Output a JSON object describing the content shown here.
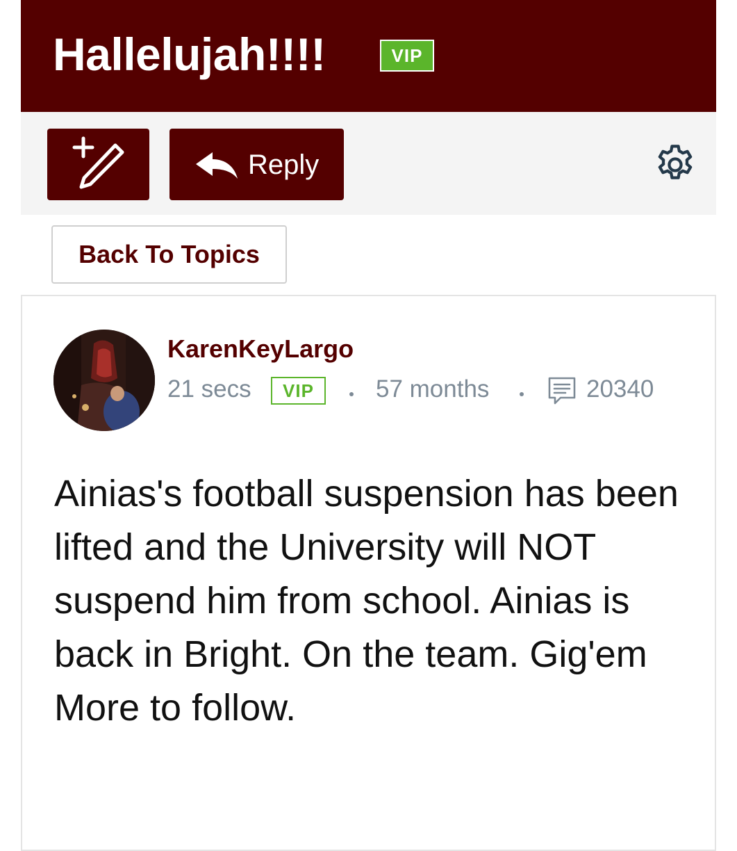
{
  "header": {
    "title": "Hallelujah!!!!",
    "vip_badge": "VIP",
    "background_color": "#540000"
  },
  "toolbar": {
    "new_topic_icon": "pencil-plus-icon",
    "reply_icon": "reply-arrow-icon",
    "reply_label": "Reply",
    "settings_icon": "gear-icon"
  },
  "nav": {
    "back_label": "Back To Topics"
  },
  "post": {
    "avatar_icon": "user-avatar",
    "username": "KarenKeyLargo",
    "time_ago": "21 secs",
    "vip_badge": "VIP",
    "member_duration": "57 months",
    "posts_icon": "message-icon",
    "post_count": "20340",
    "body": "Ainias's football suspension has been lifted and the University will NOT suspend him from school. Ainias is back in Bright. On the team. Gig'em More to follow."
  },
  "colors": {
    "accent": "#540000",
    "vip_green": "#5bb52b",
    "meta_gray": "#7d8a96"
  }
}
